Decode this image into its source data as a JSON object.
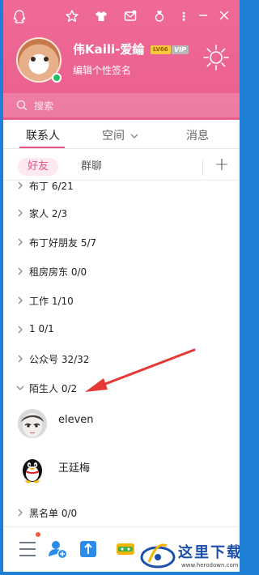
{
  "header": {
    "nickname": "伟Kaili-爱綸",
    "level_badge": "LV66",
    "vip_badge": "VIP",
    "signature": "编辑个性签名",
    "status": "online"
  },
  "search": {
    "placeholder": "搜索"
  },
  "main_tabs": [
    {
      "label": "联系人",
      "active": true
    },
    {
      "label": "空间",
      "has_dropdown": true
    },
    {
      "label": "消息"
    }
  ],
  "sub_tabs": [
    {
      "label": "好友",
      "active": true
    },
    {
      "label": "群聊"
    }
  ],
  "groups": [
    {
      "label": "布丁 6/21"
    },
    {
      "label": "家人 2/3"
    },
    {
      "label": "布丁好朋友 5/7"
    },
    {
      "label": "租房房东 0/0"
    },
    {
      "label": "工作 1/10"
    },
    {
      "label": "1 0/1"
    },
    {
      "label": "公众号 32/32"
    },
    {
      "label": "陌生人 0/2",
      "expanded": true
    },
    {
      "label": "黑名单 0/0"
    }
  ],
  "contacts": [
    {
      "name": "eleven"
    },
    {
      "name": "王廷梅"
    }
  ],
  "watermark": {
    "text": "这里下载",
    "url": "www.herodown.com"
  },
  "colors": {
    "accent": "#e7547f",
    "header": "#ea5e8e",
    "annotation": "#e53935"
  }
}
